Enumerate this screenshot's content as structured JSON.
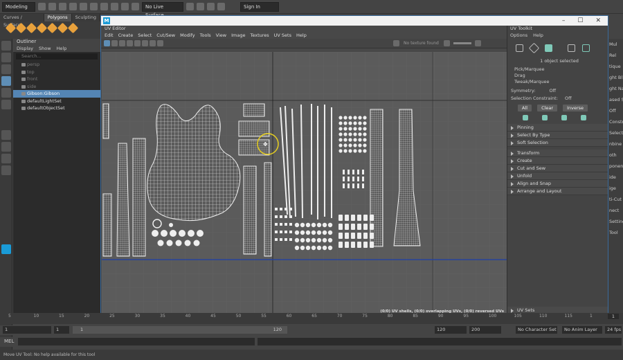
{
  "topbar": {
    "mode": "Modeling",
    "live_surface": "No Live Surface",
    "sign_in": "Sign In"
  },
  "shelf": {
    "tabs": [
      "Curves / Surfaces",
      "Polygons",
      "Sculpting"
    ]
  },
  "outliner": {
    "title": "Outliner",
    "menu": [
      "Display",
      "Show",
      "Help"
    ],
    "search_placeholder": "Search...",
    "items": [
      {
        "label": "persp",
        "dim": true
      },
      {
        "label": "top",
        "dim": true
      },
      {
        "label": "front",
        "dim": true
      },
      {
        "label": "side",
        "dim": true
      },
      {
        "label": "Gibson:Gibson",
        "selected": true
      },
      {
        "label": "defaultLightSet"
      },
      {
        "label": "defaultObjectSet"
      }
    ]
  },
  "uv_editor": {
    "title": "UV Editor",
    "menu": [
      "Edit",
      "Create",
      "Select",
      "Cut/Sew",
      "Modify",
      "Tools",
      "View",
      "Image",
      "Textures",
      "UV Sets",
      "Help"
    ],
    "texture": "No texture found",
    "status": "(0/0) UV shells, (0/0) overlapping UVs, (0/0) reversed UVs"
  },
  "uv_toolkit": {
    "title": "UV Toolkit",
    "menu": [
      "Options",
      "Help"
    ],
    "selection_status": "1 object selected",
    "tools": [
      "Pick/Marquee",
      "Drag",
      "Tweak/Marquee"
    ],
    "symmetry_label": "Symmetry:",
    "symmetry_value": "Off",
    "constraint_label": "Selection Constraint:",
    "constraint_value": "Off",
    "buttons": [
      "All",
      "Clear",
      "Inverse"
    ],
    "sections": [
      "Pinning",
      "Select By Type",
      "Soft Selection",
      "Transform",
      "Create",
      "Cut and Sew",
      "Unfold",
      "Align and Snap",
      "Arrange and Layout"
    ],
    "footer": "UV Sets"
  },
  "right_strip": [
    "Mul",
    "Rel",
    "tique",
    "ght Bl",
    "ght Na",
    "ased Sel",
    "Off",
    "Constr",
    "Selectio",
    "nbine",
    "oth",
    "ponent",
    "ide",
    "ige",
    "ti-Cut",
    "nect",
    "Setting",
    "Tool"
  ],
  "timeline": {
    "ticks": [
      "5",
      "10",
      "15",
      "20",
      "25",
      "30",
      "35",
      "40",
      "45",
      "50",
      "55",
      "60",
      "65",
      "70",
      "75",
      "80",
      "85",
      "90",
      "95",
      "100",
      "105",
      "110",
      "115",
      "1"
    ],
    "end": "1"
  },
  "range": {
    "start": "1",
    "range_start": "1",
    "range_inner_start": "1",
    "range_inner_end": "120",
    "end": "120",
    "max": "200",
    "character_set": "No Character Set",
    "anim_layer": "No Anim Layer",
    "fps": "24 fps"
  },
  "mel": {
    "label": "MEL"
  },
  "help": {
    "text": "Move UV Tool: No help available for this tool"
  },
  "colors": {
    "selection": "#5485b4",
    "window_border": "#3a6b9c",
    "uv_wire": "#e9e9e9",
    "uv_border": "#1e3fa8",
    "manip": "#e8d020"
  }
}
